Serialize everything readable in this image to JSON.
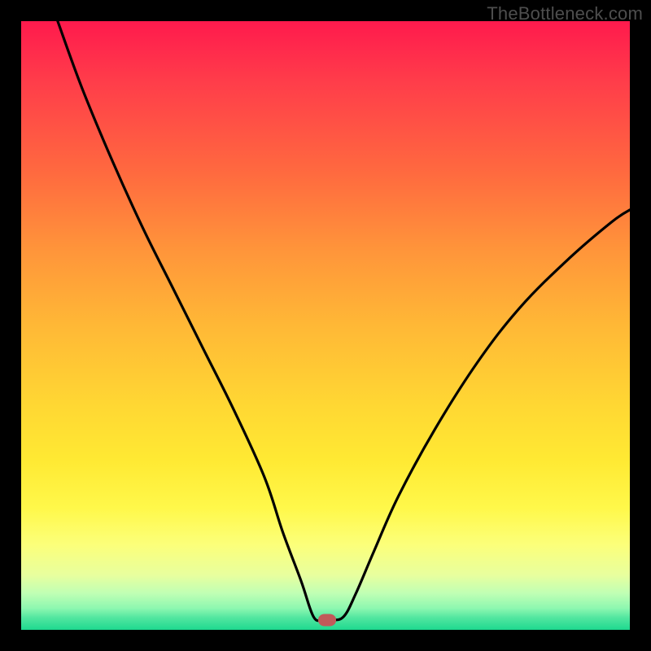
{
  "watermark": "TheBottleneck.com",
  "chart_data": {
    "type": "line",
    "title": "",
    "xlabel": "",
    "ylabel": "",
    "xlim": [
      0,
      100
    ],
    "ylim": [
      0,
      100
    ],
    "grid": false,
    "legend": false,
    "series": [
      {
        "name": "bottleneck-curve",
        "x": [
          6,
          10,
          15,
          20,
          25,
          30,
          35,
          40,
          43,
          46,
          48,
          49.5,
          51,
          53,
          55,
          58,
          62,
          68,
          75,
          82,
          90,
          97,
          100
        ],
        "y": [
          100,
          89,
          77,
          66,
          56,
          46,
          36,
          25,
          16,
          8,
          2.2,
          1.6,
          1.6,
          2.2,
          6,
          13,
          22,
          33,
          44,
          53,
          61,
          67,
          69
        ]
      }
    ],
    "marker": {
      "x": 50.3,
      "y": 1.6,
      "label": "optimal-point"
    },
    "background_gradient": {
      "top": "#ff1a4d",
      "mid": "#ffd733",
      "bottom": "#1ed98f"
    }
  }
}
